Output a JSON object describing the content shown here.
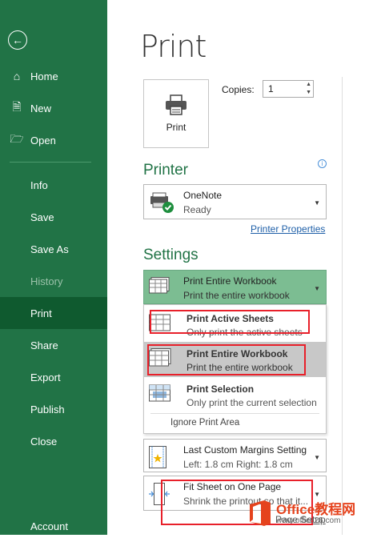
{
  "sidebar": {
    "back_icon": "back-arrow-icon",
    "items": [
      {
        "label": "Home",
        "icon": "home-icon"
      },
      {
        "label": "New",
        "icon": "new-document-icon"
      },
      {
        "label": "Open",
        "icon": "open-folder-icon"
      },
      {
        "label": "Info"
      },
      {
        "label": "Save"
      },
      {
        "label": "Save As"
      },
      {
        "label": "History",
        "state": "disabled"
      },
      {
        "label": "Print",
        "state": "active"
      },
      {
        "label": "Share"
      },
      {
        "label": "Export"
      },
      {
        "label": "Publish"
      },
      {
        "label": "Close"
      },
      {
        "label": "Account"
      }
    ]
  },
  "main": {
    "title": "Print",
    "print_button_label": "Print",
    "copies_label": "Copies:",
    "copies_value": "1"
  },
  "printer": {
    "section_title": "Printer",
    "name": "OneNote",
    "status": "Ready",
    "properties_link": "Printer Properties"
  },
  "settings": {
    "section_title": "Settings",
    "scope": {
      "main": "Print Entire Workbook",
      "sub": "Print the entire workbook"
    },
    "scope_options": [
      {
        "main": "Print Active Sheets",
        "sub": "Only print the active sheets"
      },
      {
        "main": "Print Entire Workbook",
        "sub": "Print the entire workbook",
        "selected": true
      },
      {
        "main": "Print Selection",
        "sub": "Only print the current selection"
      }
    ],
    "ignore_print_area": "Ignore Print Area",
    "margins": {
      "main": "Last Custom Margins Setting",
      "sub": "Left:  1.8 cm     Right:  1.8 cm"
    },
    "scaling": {
      "main": "Fit Sheet on One Page",
      "sub": "Shrink the printout so that it..."
    },
    "page_setup_link": "Page Setup"
  },
  "watermark": {
    "text": "Office教程网",
    "url": "www.office26.com"
  },
  "colors": {
    "sidebar": "#217346",
    "sidebar_active": "#0f5a2f",
    "accent_green": "#217346",
    "highlight": "#e8202a",
    "link": "#1e5fa8"
  }
}
